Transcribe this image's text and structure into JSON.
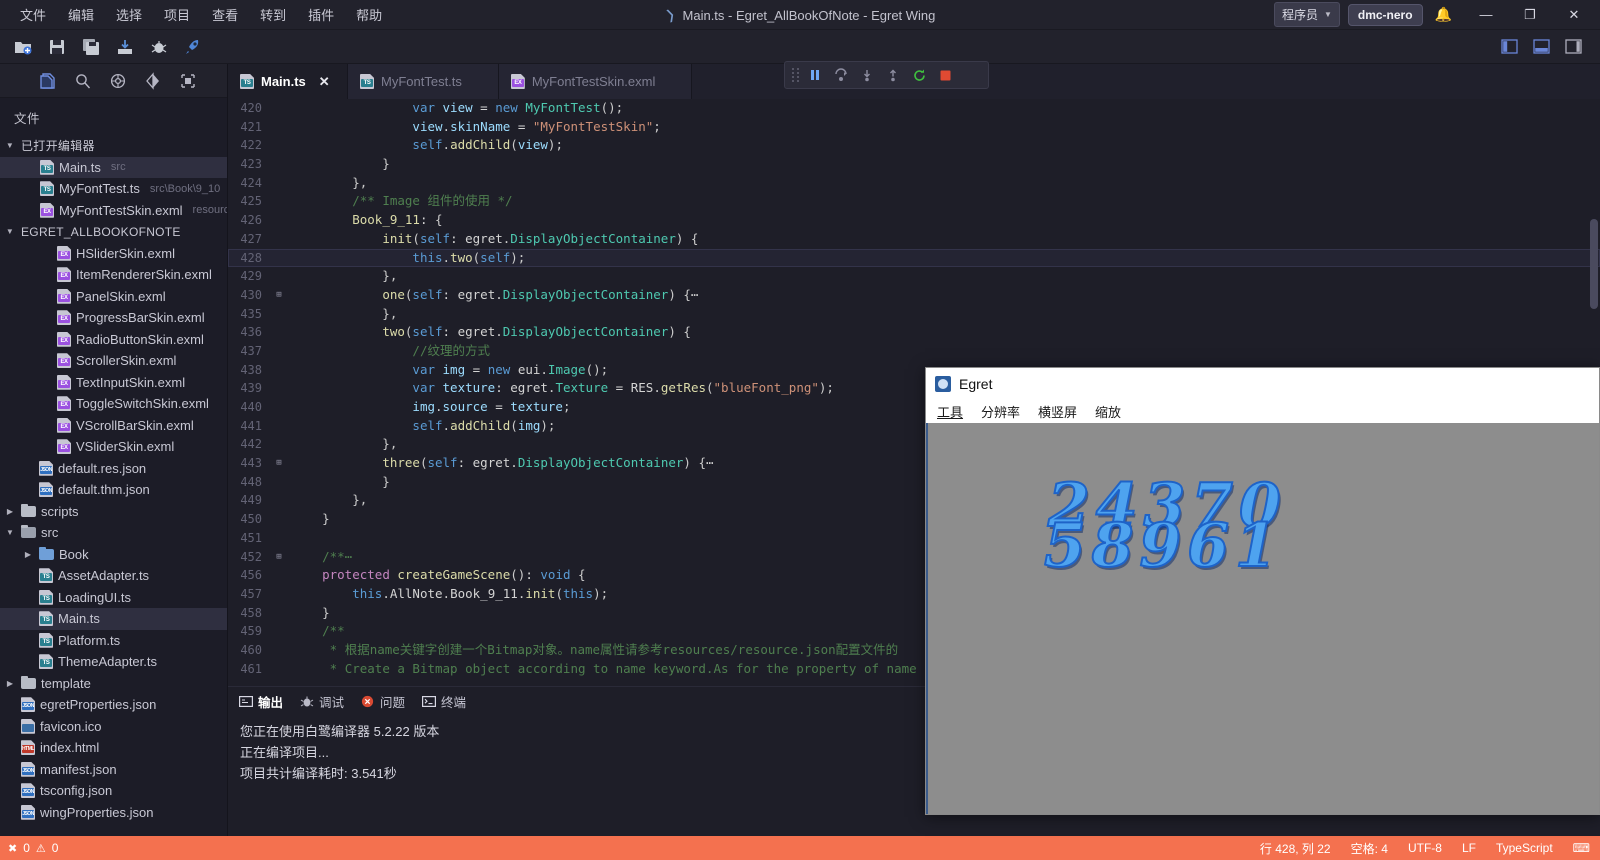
{
  "titlebar": {
    "menus": [
      "文件",
      "编辑",
      "选择",
      "项目",
      "查看",
      "转到",
      "插件",
      "帮助"
    ],
    "title": "Main.ts - Egret_AllBookOfNote - Egret Wing",
    "user_role": "程序员",
    "user_name": "dmc-nero",
    "minimize": "—",
    "maximize": "❐",
    "close": "✕"
  },
  "toolbar": {
    "icons": [
      "new-project-icon",
      "save-icon",
      "save-all-icon",
      "publish-icon",
      "debug-icon",
      "run-icon"
    ],
    "layout_icons": [
      "toggle-sidebar-icon",
      "toggle-panel-icon",
      "toggle-right-panel-icon"
    ]
  },
  "debugbar": {
    "buttons": [
      "drag-handle",
      "pause",
      "step-over",
      "step-into",
      "step-out",
      "restart",
      "stop"
    ]
  },
  "sidebar": {
    "actions": [
      "explorer-icon",
      "search-icon",
      "source-control-icon",
      "debug-icon",
      "extensions-icon"
    ],
    "title": "文件",
    "open_editors": {
      "label": "已打开编辑器",
      "items": [
        {
          "name": "Main.ts",
          "meta": "src",
          "kind": "ts",
          "selected": true
        },
        {
          "name": "MyFontTest.ts",
          "meta": "src\\Book\\9_10",
          "kind": "ts",
          "selected": false
        },
        {
          "name": "MyFontTestSkin.exml",
          "meta": "resourc...",
          "kind": "exml",
          "selected": false
        }
      ]
    },
    "project": {
      "label": "EGRET_ALLBOOKOFNOTE",
      "items": [
        {
          "name": "HSliderSkin.exml",
          "kind": "exml",
          "indent": 3
        },
        {
          "name": "ItemRendererSkin.exml",
          "kind": "exml",
          "indent": 3
        },
        {
          "name": "PanelSkin.exml",
          "kind": "exml",
          "indent": 3
        },
        {
          "name": "ProgressBarSkin.exml",
          "kind": "exml",
          "indent": 3
        },
        {
          "name": "RadioButtonSkin.exml",
          "kind": "exml",
          "indent": 3
        },
        {
          "name": "ScrollerSkin.exml",
          "kind": "exml",
          "indent": 3
        },
        {
          "name": "TextInputSkin.exml",
          "kind": "exml",
          "indent": 3
        },
        {
          "name": "ToggleSwitchSkin.exml",
          "kind": "exml",
          "indent": 3
        },
        {
          "name": "VScrollBarSkin.exml",
          "kind": "exml",
          "indent": 3
        },
        {
          "name": "VSliderSkin.exml",
          "kind": "exml",
          "indent": 3
        },
        {
          "name": "default.res.json",
          "kind": "json",
          "indent": 2
        },
        {
          "name": "default.thm.json",
          "kind": "json",
          "indent": 2
        },
        {
          "name": "scripts",
          "kind": "folder",
          "indent": 1,
          "arrow": "right"
        },
        {
          "name": "src",
          "kind": "folder-open",
          "indent": 1,
          "arrow": "down"
        },
        {
          "name": "Book",
          "kind": "folder-blue",
          "indent": 2,
          "arrow": "right"
        },
        {
          "name": "AssetAdapter.ts",
          "kind": "ts",
          "indent": 2
        },
        {
          "name": "LoadingUI.ts",
          "kind": "ts",
          "indent": 2
        },
        {
          "name": "Main.ts",
          "kind": "ts",
          "indent": 2,
          "selected": true
        },
        {
          "name": "Platform.ts",
          "kind": "ts",
          "indent": 2
        },
        {
          "name": "ThemeAdapter.ts",
          "kind": "ts",
          "indent": 2
        },
        {
          "name": "template",
          "kind": "folder",
          "indent": 1,
          "arrow": "right"
        },
        {
          "name": "egretProperties.json",
          "kind": "json",
          "indent": 1
        },
        {
          "name": "favicon.ico",
          "kind": "ico",
          "indent": 1
        },
        {
          "name": "index.html",
          "kind": "html",
          "indent": 1
        },
        {
          "name": "manifest.json",
          "kind": "json",
          "indent": 1
        },
        {
          "name": "tsconfig.json",
          "kind": "json",
          "indent": 1
        },
        {
          "name": "wingProperties.json",
          "kind": "json",
          "indent": 1
        }
      ]
    }
  },
  "tabs": [
    {
      "label": "Main.ts",
      "kind": "ts",
      "active": true
    },
    {
      "label": "MyFontTest.ts",
      "kind": "ts",
      "active": false
    },
    {
      "label": "MyFontTestSkin.exml",
      "kind": "exml",
      "active": false
    }
  ],
  "code": {
    "lines": [
      {
        "n": "420",
        "fold": "",
        "hl": false,
        "html": "                <span class=\"kw\">var</span> <span class=\"var\">view</span> <span class=\"op\">=</span> <span class=\"kw\">new</span> <span class=\"typ\">MyFontTest</span>();"
      },
      {
        "n": "421",
        "fold": "",
        "hl": false,
        "html": "                <span class=\"var\">view</span>.<span class=\"var\">skinName</span> <span class=\"op\">=</span> <span class=\"str\">\"MyFontTestSkin\"</span>;"
      },
      {
        "n": "422",
        "fold": "",
        "hl": false,
        "html": "                <span class=\"kw\">self</span>.<span class=\"fn\">addChild</span>(<span class=\"var\">view</span>);"
      },
      {
        "n": "423",
        "fold": "",
        "hl": false,
        "html": "            }"
      },
      {
        "n": "424",
        "fold": "",
        "hl": false,
        "html": "        },"
      },
      {
        "n": "425",
        "fold": "",
        "hl": false,
        "html": "        <span class=\"cmt\">/** Image 组件的使用 */</span>"
      },
      {
        "n": "426",
        "fold": "",
        "hl": false,
        "html": "        <span class=\"fn\">Book_9_11</span><span class=\"op\">:</span> {"
      },
      {
        "n": "427",
        "fold": "",
        "hl": false,
        "html": "            <span class=\"fn\">init</span>(<span class=\"kw\">self</span><span class=\"op\">:</span> <span class=\"pl\">egret</span>.<span class=\"typ\">DisplayObjectContainer</span>) {"
      },
      {
        "n": "428",
        "fold": "",
        "hl": true,
        "html": "                <span class=\"kw\">this</span>.<span class=\"fn\">two</span>(<span class=\"kw\">self</span>);"
      },
      {
        "n": "429",
        "fold": "",
        "hl": false,
        "html": "            },"
      },
      {
        "n": "430",
        "fold": "+",
        "hl": false,
        "html": "            <span class=\"fn\">one</span>(<span class=\"kw\">self</span><span class=\"op\">:</span> <span class=\"pl\">egret</span>.<span class=\"typ\">DisplayObjectContainer</span>) {⋯"
      },
      {
        "n": "435",
        "fold": "",
        "hl": false,
        "html": "            },"
      },
      {
        "n": "436",
        "fold": "",
        "hl": false,
        "html": "            <span class=\"fn\">two</span>(<span class=\"kw\">self</span><span class=\"op\">:</span> <span class=\"pl\">egret</span>.<span class=\"typ\">DisplayObjectContainer</span>) {"
      },
      {
        "n": "437",
        "fold": "",
        "hl": false,
        "html": "                <span class=\"cmt\">//纹理的方式</span>"
      },
      {
        "n": "438",
        "fold": "",
        "hl": false,
        "html": "                <span class=\"kw\">var</span> <span class=\"var\">img</span> <span class=\"op\">=</span> <span class=\"kw\">new</span> <span class=\"pl\">eui</span>.<span class=\"typ\">Image</span>();"
      },
      {
        "n": "439",
        "fold": "",
        "hl": false,
        "html": "                <span class=\"kw\">var</span> <span class=\"var\">texture</span><span class=\"op\">:</span> <span class=\"pl\">egret</span>.<span class=\"typ\">Texture</span> <span class=\"op\">=</span> <span class=\"pl\">RES</span>.<span class=\"fn\">getRes</span>(<span class=\"str\">\"blueFont_png\"</span>);"
      },
      {
        "n": "440",
        "fold": "",
        "hl": false,
        "html": "                <span class=\"var\">img</span>.<span class=\"var\">source</span> <span class=\"op\">=</span> <span class=\"var\">texture</span>;"
      },
      {
        "n": "441",
        "fold": "",
        "hl": false,
        "html": "                <span class=\"kw\">self</span>.<span class=\"fn\">addChild</span>(<span class=\"var\">img</span>);"
      },
      {
        "n": "442",
        "fold": "",
        "hl": false,
        "html": "            },"
      },
      {
        "n": "443",
        "fold": "+",
        "hl": false,
        "html": "            <span class=\"fn\">three</span>(<span class=\"kw\">self</span><span class=\"op\">:</span> <span class=\"pl\">egret</span>.<span class=\"typ\">DisplayObjectContainer</span>) {⋯"
      },
      {
        "n": "448",
        "fold": "",
        "hl": false,
        "html": "            }"
      },
      {
        "n": "449",
        "fold": "",
        "hl": false,
        "html": "        },"
      },
      {
        "n": "450",
        "fold": "",
        "hl": false,
        "html": "    }"
      },
      {
        "n": "451",
        "fold": "",
        "hl": false,
        "html": ""
      },
      {
        "n": "452",
        "fold": "+",
        "hl": false,
        "html": "    <span class=\"cmt\">/**⋯</span>"
      },
      {
        "n": "456",
        "fold": "",
        "hl": false,
        "html": "    <span class=\"kw2\">protected</span> <span class=\"fn\">createGameScene</span>()<span class=\"op\">:</span> <span class=\"kw\">void</span> {"
      },
      {
        "n": "457",
        "fold": "",
        "hl": false,
        "html": "        <span class=\"kw\">this</span>.<span class=\"pl\">AllNote</span>.<span class=\"pl\">Book_9_11</span>.<span class=\"fn\">init</span>(<span class=\"kw\">this</span>);"
      },
      {
        "n": "458",
        "fold": "",
        "hl": false,
        "html": "    }"
      },
      {
        "n": "459",
        "fold": "",
        "hl": false,
        "html": "    <span class=\"cmt\">/**</span>"
      },
      {
        "n": "460",
        "fold": "",
        "hl": false,
        "html": "     <span class=\"cmt\">* 根据name关键字创建一个Bitmap对象。name属性请参考resources/resource.json配置文件的</span>"
      },
      {
        "n": "461",
        "fold": "",
        "hl": false,
        "html": "     <span class=\"cmt\">* Create a Bitmap object according to name keyword.As for the property of name</span>"
      }
    ]
  },
  "panel": {
    "tabs": [
      {
        "label": "输出",
        "icon": "output-icon",
        "active": true
      },
      {
        "label": "调试",
        "icon": "debug-icon",
        "active": false
      },
      {
        "label": "问题",
        "icon": "problems-icon",
        "active": false
      },
      {
        "label": "终端",
        "icon": "terminal-icon",
        "active": false
      }
    ],
    "output": [
      "您正在使用白鹭编译器 5.2.22 版本",
      "正在编译项目...",
      "项目共计编译耗时: 3.541秒"
    ]
  },
  "egret": {
    "window_title": "Egret",
    "menus": [
      "工具",
      "分辨率",
      "横竖屏",
      "缩放"
    ],
    "stage_text_line1": "24370",
    "stage_text_line2": "58961"
  },
  "status": {
    "errors": "0",
    "warnings": "0",
    "position": "行 428, 列 22",
    "indent": "空格: 4",
    "encoding": "UTF-8",
    "eol": "LF",
    "language": "TypeScript",
    "bg_color": "#f4714f"
  }
}
